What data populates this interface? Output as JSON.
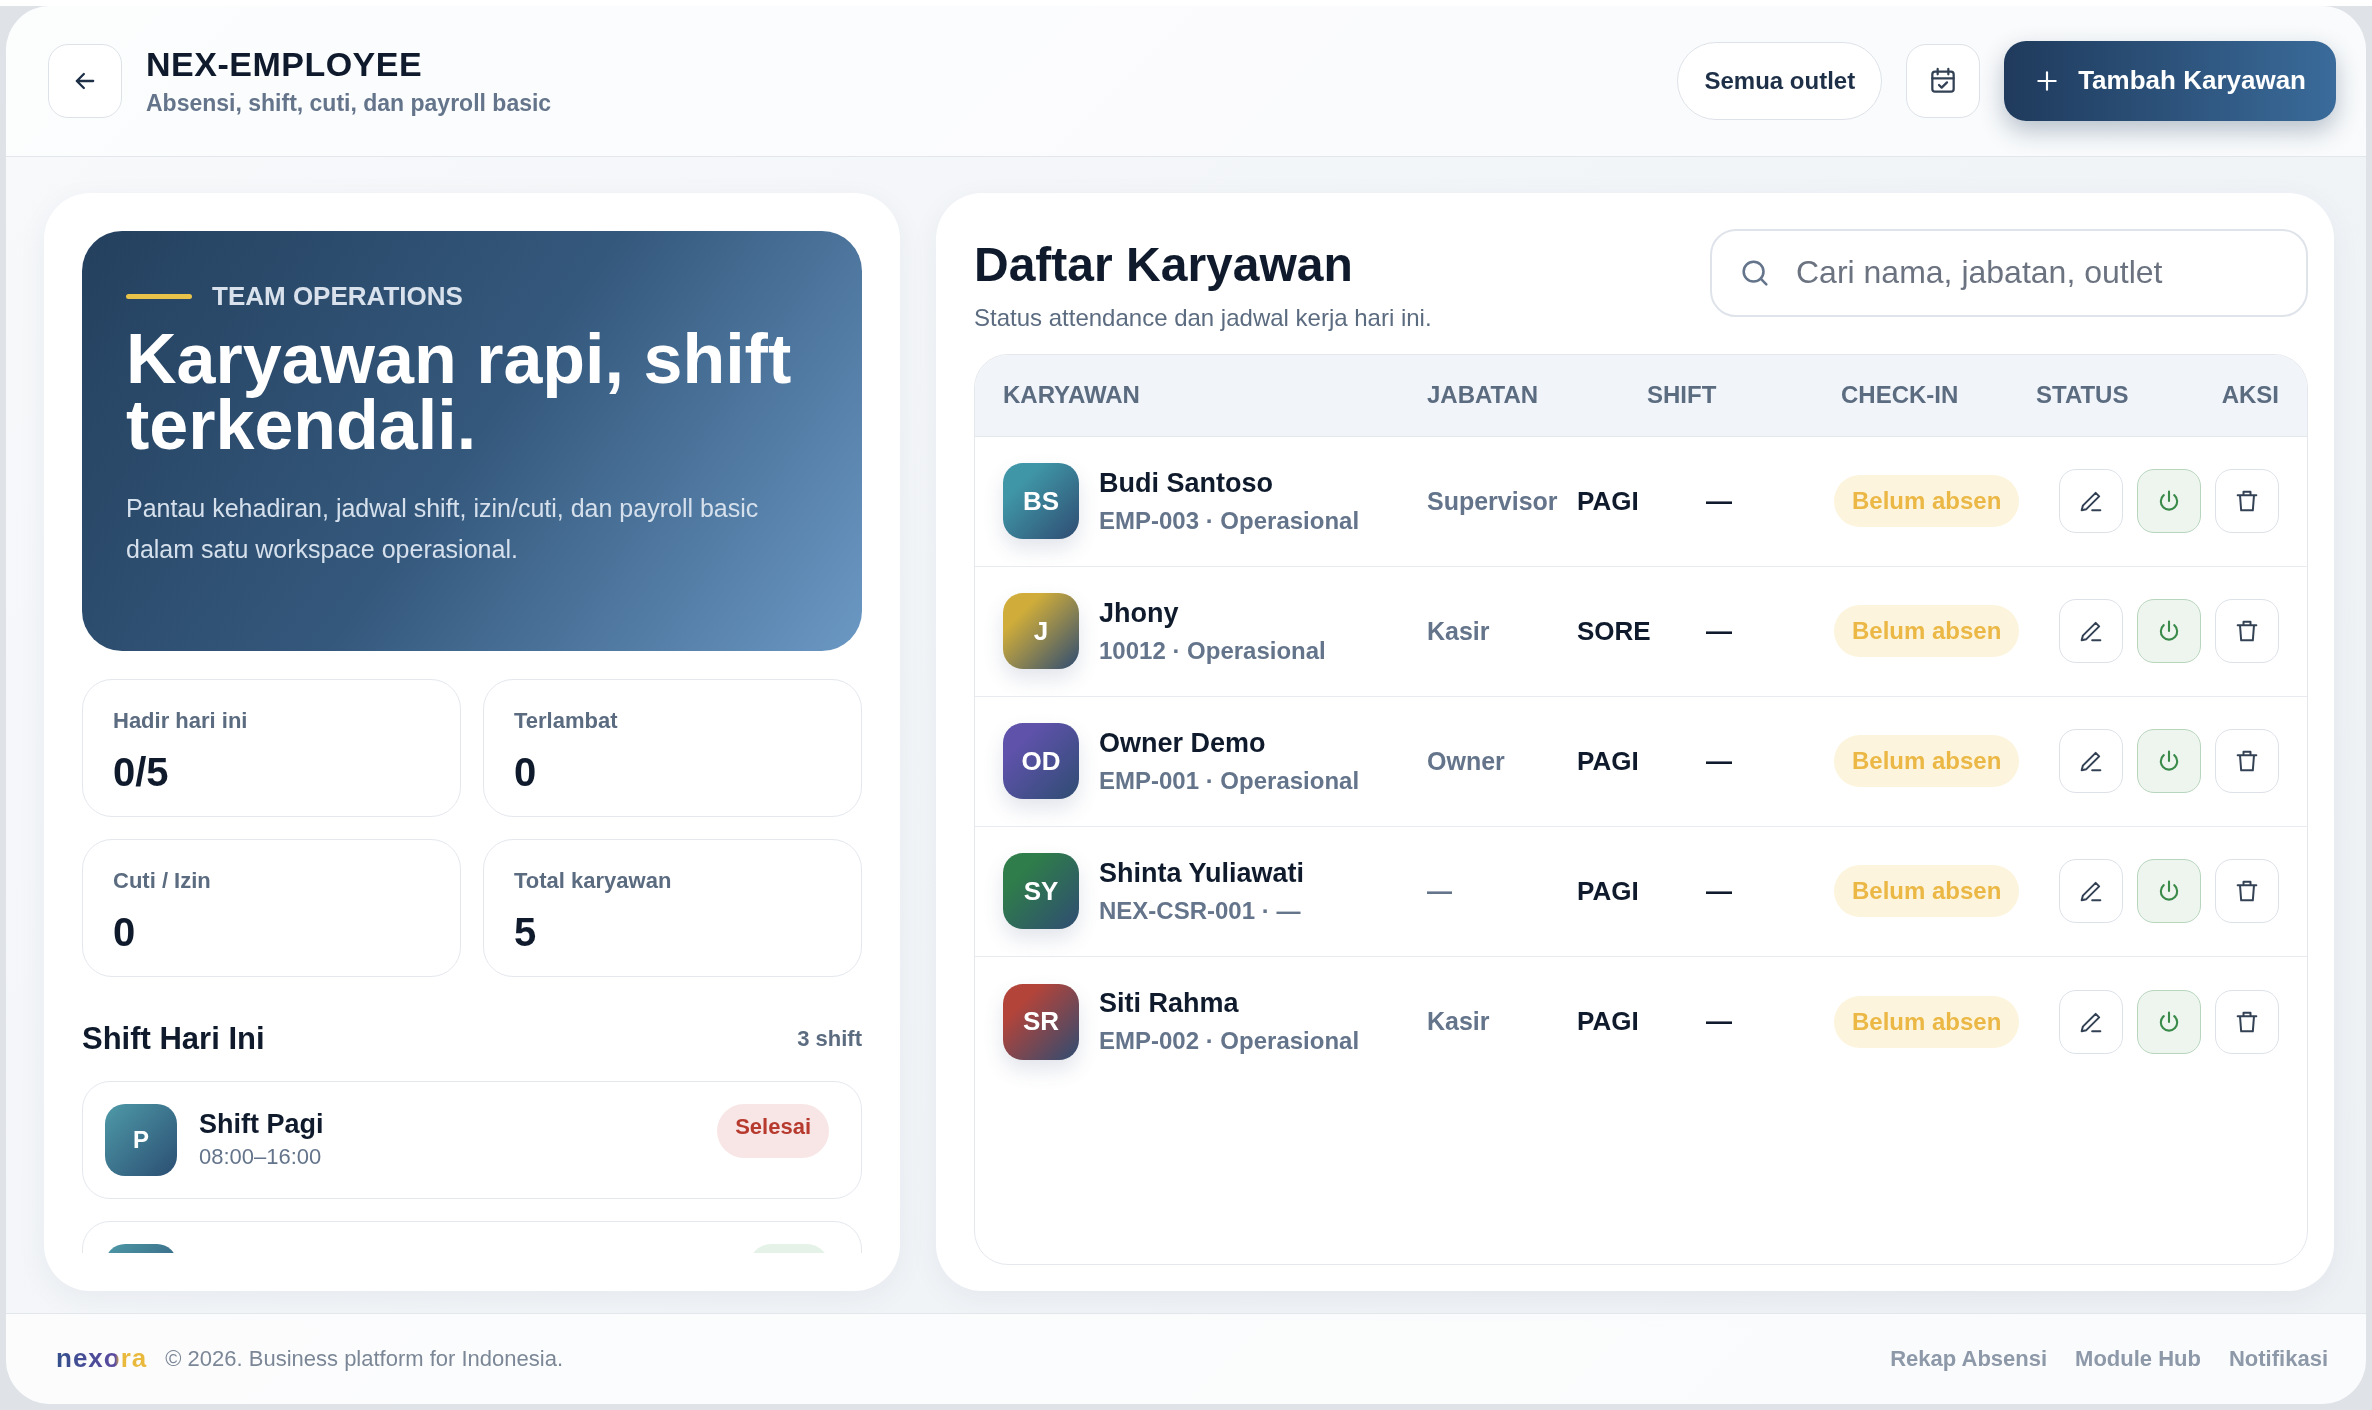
{
  "header": {
    "title": "NEX-EMPLOYEE",
    "subtitle": "Absensi, shift, cuti, dan payroll basic",
    "outlet_button": "Semua outlet",
    "add_button": "Tambah Karyawan"
  },
  "hero": {
    "eyebrow": "TEAM OPERATIONS",
    "title": "Karyawan rapi, shift terkendali.",
    "text": "Pantau kehadiran, jadwal shift, izin/cuti, dan payroll basic dalam satu workspace operasional."
  },
  "stats": [
    {
      "label": "Hadir hari ini",
      "value": "0/5"
    },
    {
      "label": "Terlambat",
      "value": "0"
    },
    {
      "label": "Cuti / Izin",
      "value": "0"
    },
    {
      "label": "Total karyawan",
      "value": "5"
    }
  ],
  "shifts": {
    "title": "Shift Hari Ini",
    "count": "3 shift",
    "items": [
      {
        "initial": "P",
        "name": "Shift Pagi",
        "time": "08:00–16:00",
        "status": "Selesai",
        "kind": "done"
      },
      {
        "kind": "active"
      }
    ]
  },
  "employees": {
    "title": "Daftar Karyawan",
    "subtitle": "Status attendance dan jadwal kerja hari ini.",
    "search": {
      "placeholder": "Cari nama, jabatan, outlet"
    },
    "columns": [
      "KARYAWAN",
      "JABATAN",
      "SHIFT",
      "CHECK-IN",
      "STATUS",
      "AKSI"
    ],
    "rows": [
      {
        "initials": "BS",
        "color": "#3f96a6",
        "name": "Budi Santoso",
        "meta": "EMP-003 · Operasional",
        "position": "Supervisor",
        "shift": "PAGI",
        "check_in": "—",
        "status": "Belum absen"
      },
      {
        "initials": "J",
        "color": "#d0ad3a",
        "name": "Jhony",
        "meta": "10012 · Operasional",
        "position": "Kasir",
        "shift": "SORE",
        "check_in": "—",
        "status": "Belum absen"
      },
      {
        "initials": "OD",
        "color": "#5e52aa",
        "name": "Owner Demo",
        "meta": "EMP-001 · Operasional",
        "position": "Owner",
        "shift": "PAGI",
        "check_in": "—",
        "status": "Belum absen"
      },
      {
        "initials": "SY",
        "color": "#2f7d4a",
        "name": "Shinta Yuliawati",
        "meta": "NEX-CSR-001 · —",
        "position": "—",
        "shift": "PAGI",
        "check_in": "—",
        "status": "Belum absen"
      },
      {
        "initials": "SR",
        "color": "#b3443a",
        "name": "Siti Rahma",
        "meta": "EMP-002 · Operasional",
        "position": "Kasir",
        "shift": "PAGI",
        "check_in": "—",
        "status": "Belum absen"
      }
    ]
  },
  "footer": {
    "logo": "nexora",
    "copyright": "© 2026. Business platform for Indonesia.",
    "links": [
      "Rekap Absensi",
      "Module Hub",
      "Notifikasi"
    ]
  }
}
